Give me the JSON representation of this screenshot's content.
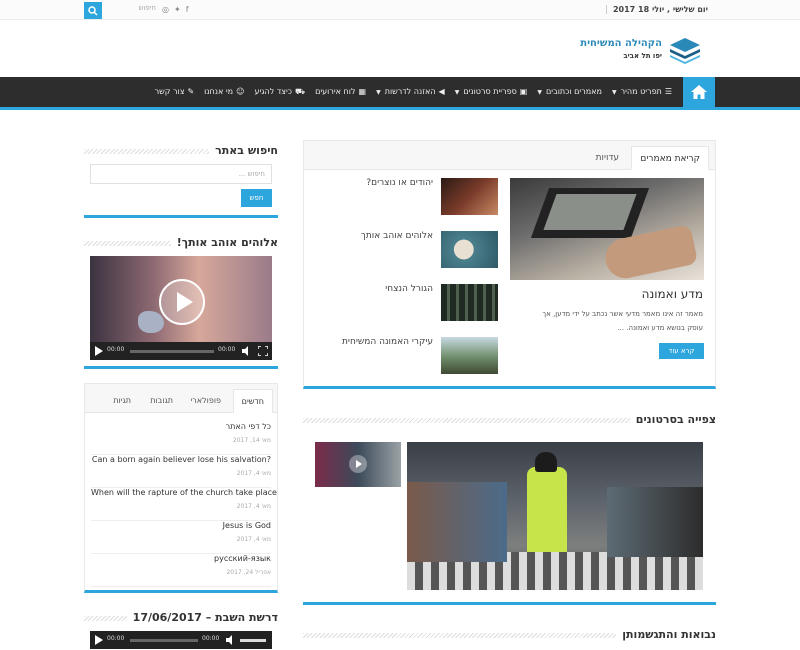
{
  "topbar": {
    "date": "יום שלישי , יולי 18 2017",
    "search_placeholder": "חיפוש",
    "social": [
      "facebook-icon",
      "twitter-icon",
      "instagram-icon"
    ]
  },
  "logo": {
    "title": "הקהילה המשיחית",
    "subtitle": "יפו תל אביב"
  },
  "nav": {
    "items": [
      {
        "label": "תפריט מהיר",
        "icon": "☰",
        "arrow": true
      },
      {
        "label": "מאמרים וכתובים",
        "icon": "",
        "arrow": true
      },
      {
        "label": "ספריית סרטונים",
        "icon": "▣",
        "arrow": true
      },
      {
        "label": "האזנה לדרשות",
        "icon": "◀",
        "arrow": true
      },
      {
        "label": "לוח אירועים",
        "icon": "▦",
        "arrow": false
      },
      {
        "label": "כיצד להגיע",
        "icon": "⛟",
        "arrow": false
      },
      {
        "label": "מי אנחנו",
        "icon": "☺",
        "arrow": false
      },
      {
        "label": "צור קשר",
        "icon": "✎",
        "arrow": false
      }
    ]
  },
  "featured": {
    "tabs": [
      "קריאת מאמרים",
      "עדויות"
    ],
    "main_title": "מדע ואמונה",
    "main_excerpt_1": "מאמר זה אינו מאמר מדעי אשר נכתב על ידי מדען, אך",
    "main_excerpt_2": "עוסק בנושא מדע ואמונה. ...",
    "read_more": "קרא עוד",
    "list": [
      "יהודים או נוצרים?",
      "אלוהים אוהב אותך",
      "הגורל הנצחי",
      "עיקרי האמונה המשיחית"
    ]
  },
  "videos_section": {
    "title": "צפייה בסרטונים"
  },
  "prophecy_section": {
    "title": "נבואות והתגשמותן"
  },
  "sidebar": {
    "search": {
      "title": "חיפוש באתר",
      "placeholder": "חיפוש ...",
      "button": "חפש"
    },
    "video": {
      "title": "אלוהים אוהב אותך!",
      "time_a": "00:00",
      "time_b": "00:00"
    },
    "tabs": [
      "חדשים",
      "פופולארי",
      "תגובות",
      "תגיות"
    ],
    "recent": [
      {
        "title": "כל דפי האתר",
        "date": "מאי 14, 2017"
      },
      {
        "title": "Can a born again believer lose his salvation?",
        "date": "מאי 4, 2017"
      },
      {
        "title": "When will the rapture of the church take place",
        "date": "מאי 4, 2017"
      },
      {
        "title": "Jesus is God",
        "date": "מאי 4, 2017"
      },
      {
        "title": "русский-язык",
        "date": "אפריל 24, 2017"
      }
    ],
    "sermon": {
      "title": "דרשת השבת – 17/06/2017",
      "time_a": "00:00",
      "time_b": "00:00"
    }
  }
}
